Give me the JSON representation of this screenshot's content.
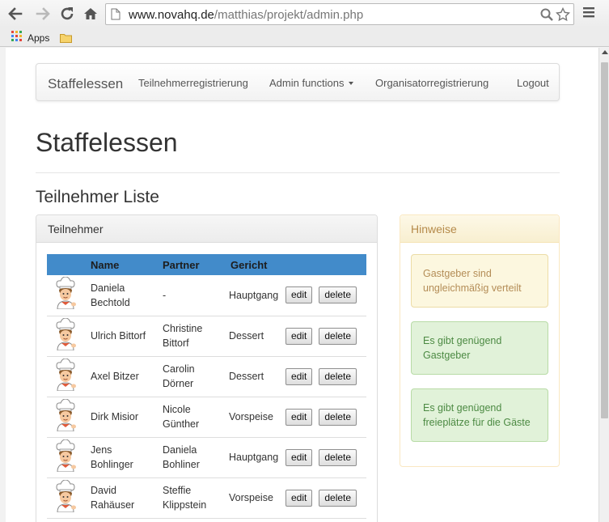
{
  "browser": {
    "url_host": "www.novahq.de",
    "url_path": "/matthias/projekt/admin.php",
    "bookmarks": {
      "apps_label": "Apps"
    }
  },
  "navbar": {
    "brand": "Staffelessen",
    "links": {
      "registration": "Teilnehmerregistrierung",
      "admin": "Admin functions",
      "organizer": "Organisatorregistrierung",
      "logout": "Logout"
    }
  },
  "page": {
    "title": "Staffelessen",
    "subtitle": "Teilnehmer Liste"
  },
  "participants_panel": {
    "heading": "Teilnehmer",
    "columns": {
      "name": "Name",
      "partner": "Partner",
      "dish": "Gericht"
    },
    "edit_label": "edit",
    "delete_label": "delete",
    "rows": [
      {
        "name": "Daniela Bechtold",
        "partner": "-",
        "dish": "Hauptgang"
      },
      {
        "name": "Ulrich Bittorf",
        "partner": "Christine Bittorf",
        "dish": "Dessert"
      },
      {
        "name": "Axel Bitzer",
        "partner": "Carolin Dörner",
        "dish": "Dessert"
      },
      {
        "name": "Dirk Misior",
        "partner": "Nicole Günther",
        "dish": "Vorspeise"
      },
      {
        "name": "Jens Bohlinger",
        "partner": "Daniela Bohliner",
        "dish": "Hauptgang"
      },
      {
        "name": "David Rahäuser",
        "partner": "Steffie Klippstein",
        "dish": "Vorspeise"
      }
    ]
  },
  "hints_panel": {
    "heading": "Hinweise",
    "alerts": [
      {
        "type": "warning",
        "text": "Gastgeber sind ungleichmäßig verteilt"
      },
      {
        "type": "success",
        "text": "Es gibt genügend Gastgeber"
      },
      {
        "type": "success",
        "text": "Es gibt genügend freieplätze für die Gäste"
      }
    ]
  },
  "colors": {
    "table_header": "#428bca",
    "warning_text": "#b48d57",
    "success_text": "#4c8a43"
  },
  "icons": {
    "row_avatar": "chef-icon",
    "toolbar": [
      "back-arrow-icon",
      "forward-arrow-icon",
      "reload-icon",
      "home-icon",
      "page-icon",
      "search-icon",
      "star-icon",
      "menu-icon"
    ]
  }
}
